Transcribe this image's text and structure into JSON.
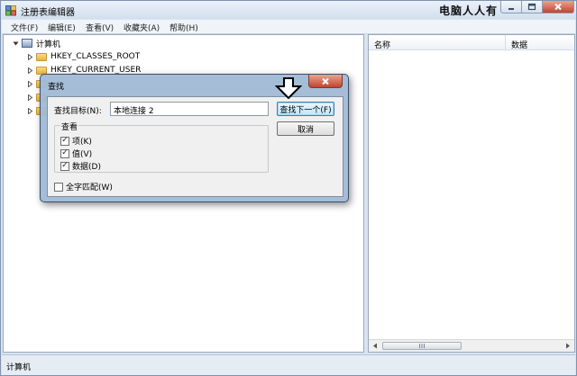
{
  "window": {
    "title": "注册表编辑器",
    "watermark": "电脑人人有"
  },
  "menubar": {
    "items": [
      "文件(F)",
      "编辑(E)",
      "查看(V)",
      "收藏夹(A)",
      "帮助(H)"
    ]
  },
  "tree": {
    "root": "计算机",
    "items": [
      {
        "label": "HKEY_CLASSES_ROOT",
        "obscured": false
      },
      {
        "label": "HKEY_CURRENT_USER",
        "obscured": false
      },
      {
        "label": "",
        "obscured": true
      },
      {
        "label": "",
        "obscured": true
      },
      {
        "label": "",
        "obscured": true
      }
    ]
  },
  "values_pane": {
    "col_name": "名称",
    "col_data": "数据"
  },
  "statusbar": {
    "text": "计算机"
  },
  "find_dialog": {
    "title": "查找",
    "find_label": "查找目标(N):",
    "find_value": "本地连接 2",
    "find_next_label": "查找下一个(F)",
    "cancel_label": "取消",
    "look_at_title": "查看",
    "checkboxes": [
      {
        "label": "项(K)",
        "checked": true
      },
      {
        "label": "值(V)",
        "checked": true
      },
      {
        "label": "数据(D)",
        "checked": true
      }
    ],
    "match_whole_label": "全字匹配(W)",
    "match_whole_checked": false
  },
  "colors": {
    "accent": "#3c7fb1",
    "close_red": "#c4442c",
    "folder_yellow": "#e6b43c"
  }
}
